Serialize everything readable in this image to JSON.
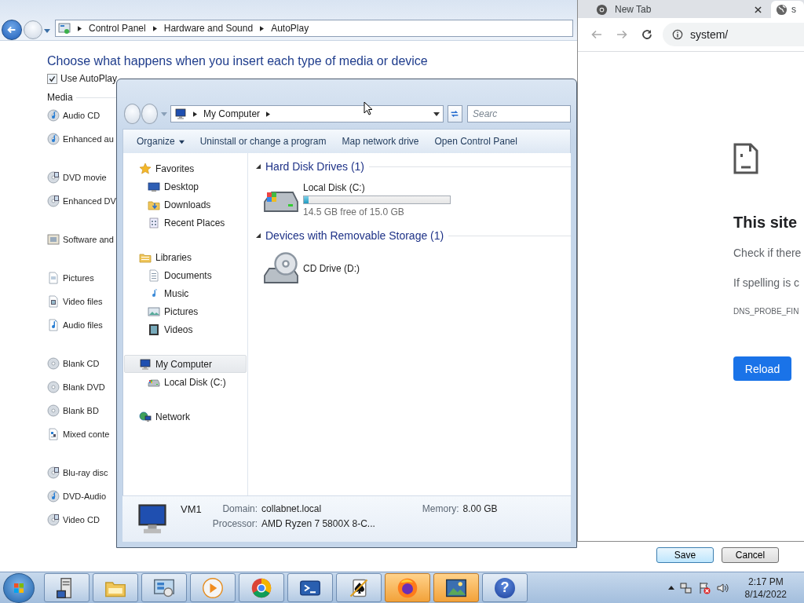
{
  "control_panel": {
    "breadcrumb": [
      "Control Panel",
      "Hardware and Sound",
      "AutoPlay"
    ],
    "heading": "Choose what happens when you insert each type of media or device",
    "autoplay_checkbox": {
      "label": "Use AutoPlay",
      "checked": true
    },
    "media_label": "Media",
    "media_groups": [
      [
        {
          "kind": "cd",
          "label": "Audio CD"
        },
        {
          "kind": "cd",
          "label": "Enhanced au"
        }
      ],
      [
        {
          "kind": "dvd",
          "label": "DVD movie"
        },
        {
          "kind": "dvd",
          "label": "Enhanced DV"
        }
      ],
      [
        {
          "kind": "software",
          "label": "Software and"
        }
      ],
      [
        {
          "kind": "file",
          "label": "Pictures"
        },
        {
          "kind": "videofile",
          "label": "Video files"
        },
        {
          "kind": "audiofile",
          "label": "Audio files"
        }
      ],
      [
        {
          "kind": "blank",
          "label": "Blank CD"
        },
        {
          "kind": "blank",
          "label": "Blank DVD"
        },
        {
          "kind": "blank",
          "label": "Blank BD"
        },
        {
          "kind": "mixed",
          "label": "Mixed conte"
        }
      ],
      [
        {
          "kind": "dvd",
          "label": "Blu-ray disc"
        },
        {
          "kind": "cd",
          "label": "DVD-Audio"
        },
        {
          "kind": "dvd",
          "label": "Video CD"
        }
      ]
    ],
    "buttons": [
      {
        "label": "Save",
        "default": true
      },
      {
        "label": "Cancel",
        "default": false
      }
    ]
  },
  "explorer": {
    "address": "My Computer",
    "search_placeholder": "Searc",
    "toolbar": [
      {
        "label": "Organize",
        "dropdown": true
      },
      {
        "label": "Uninstall or change a program",
        "dropdown": false
      },
      {
        "label": "Map network drive",
        "dropdown": false
      },
      {
        "label": "Open Control Panel",
        "dropdown": false
      }
    ],
    "nav": [
      {
        "kind": "star",
        "label": "Favorites",
        "selected": false,
        "children": [
          {
            "kind": "desktop",
            "label": "Desktop",
            "selected": false
          },
          {
            "kind": "downloads",
            "label": "Downloads",
            "selected": false
          },
          {
            "kind": "recent",
            "label": "Recent Places",
            "selected": false
          }
        ]
      },
      {
        "kind": "libraries",
        "label": "Libraries",
        "selected": false,
        "children": [
          {
            "kind": "document",
            "label": "Documents",
            "selected": false
          },
          {
            "kind": "music",
            "label": "Music",
            "selected": false
          },
          {
            "kind": "picture",
            "label": "Pictures",
            "selected": false
          },
          {
            "kind": "video",
            "label": "Videos",
            "selected": false
          }
        ]
      },
      {
        "kind": "computer",
        "label": "My Computer",
        "selected": true,
        "children": [
          {
            "kind": "drive",
            "label": "Local Disk (C:)",
            "selected": false
          }
        ]
      },
      {
        "kind": "network",
        "label": "Network",
        "selected": false
      }
    ],
    "groups": [
      {
        "title": "Hard Disk Drives (1)",
        "items": [
          {
            "kind": "drive",
            "name": "Local Disk (C:)",
            "level": 0.03,
            "free": "14.5 GB free of 15.0 GB"
          }
        ]
      },
      {
        "title": "Devices with Removable Storage (1)",
        "items": [
          {
            "kind": "cddrive",
            "name": "CD Drive (D:)"
          }
        ]
      }
    ],
    "details": {
      "name": "VM1",
      "fields": [
        {
          "label": "Domain:",
          "value": "collabnet.local"
        },
        {
          "label": "Memory:",
          "value": "8.00 GB"
        },
        {
          "label": "Processor:",
          "value": "AMD Ryzen 7 5800X 8-C..."
        }
      ]
    }
  },
  "browser": {
    "tabs": [
      {
        "title": "New Tab",
        "selected": false
      },
      {
        "title": "s",
        "selected": true
      }
    ],
    "url": "system/",
    "error": {
      "heading": "This site",
      "lines": [
        "Check if there",
        "If spelling is c"
      ],
      "code": "DNS_PROBE_FIN",
      "button": "Reload"
    }
  },
  "taskbar": {
    "apps": [
      {
        "kind": "server",
        "flashing": false
      },
      {
        "kind": "explorer",
        "flashing": false
      },
      {
        "kind": "control",
        "flashing": false
      },
      {
        "kind": "media",
        "flashing": false
      },
      {
        "kind": "chrome",
        "flashing": false
      },
      {
        "kind": "powershell",
        "flashing": false
      },
      {
        "kind": "solitaire",
        "flashing": false
      },
      {
        "kind": "firefox",
        "flashing": true
      },
      {
        "kind": "photos",
        "flashing": true
      },
      {
        "kind": "help",
        "flashing": false,
        "glyph": "?"
      }
    ],
    "clock": {
      "time": "2:17 PM",
      "date": "8/14/2022"
    }
  }
}
